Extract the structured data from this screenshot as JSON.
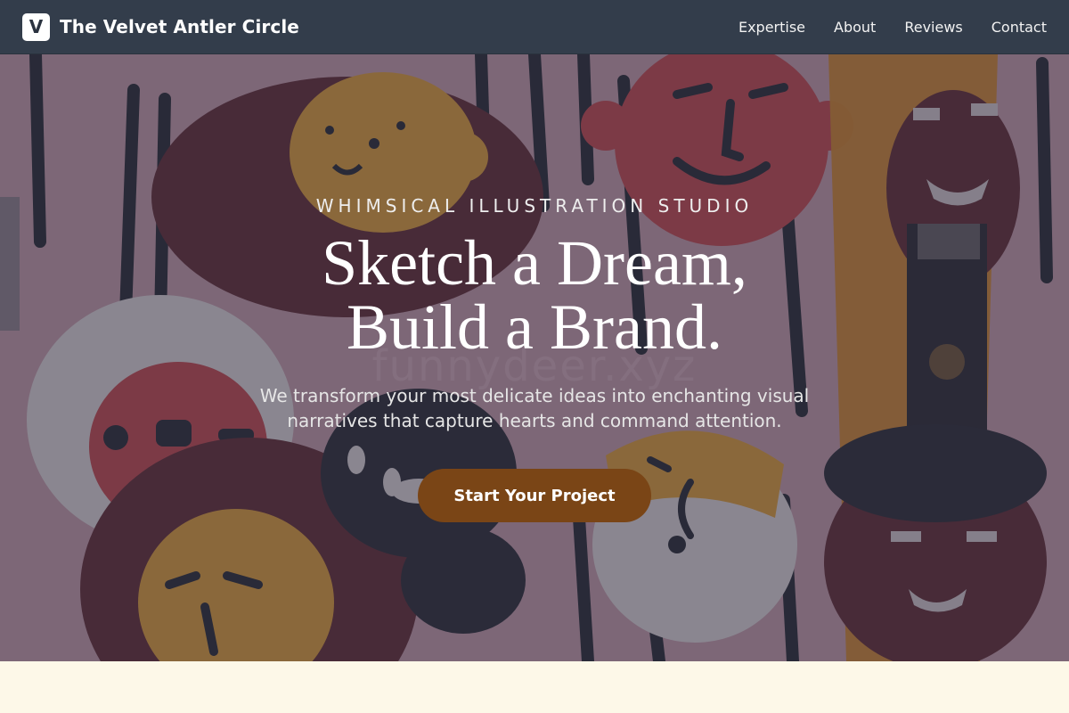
{
  "header": {
    "logo_letter": "V",
    "brand_name": "The Velvet Antler Circle",
    "nav": [
      "Expertise",
      "About",
      "Reviews",
      "Contact"
    ]
  },
  "hero": {
    "eyebrow": "WHIMSICAL ILLUSTRATION STUDIO",
    "headline_line1": "Sketch a Dream,",
    "headline_line2": "Build a Brand.",
    "subtext_line1": "We transform your most delicate ideas into enchanting visual",
    "subtext_line2": "narratives that capture hearts and command attention.",
    "cta_label": "Start Your Project",
    "watermark": "funnydeer.xyz"
  },
  "colors": {
    "nav_bg": "#333d4b",
    "cta_bg": "#7a4516",
    "page_bg": "#fdf8e8"
  }
}
